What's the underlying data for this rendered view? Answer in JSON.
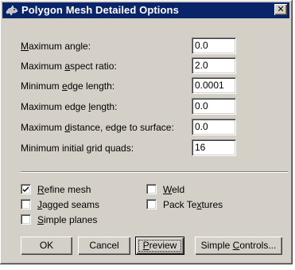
{
  "window": {
    "title": "Polygon Mesh Detailed Options",
    "close_glyph": "✕",
    "app_icon": "rhino-icon",
    "colors": {
      "titlebar": "#0a246a",
      "face": "#d4d0c8"
    }
  },
  "fields": [
    {
      "label_acc": "M",
      "label_rest": "aximum angle:",
      "value": "0.0"
    },
    {
      "label_pre": "Maximum ",
      "label_acc": "a",
      "label_rest": "spect ratio:",
      "value": "2.0"
    },
    {
      "label_pre": "Minimum ",
      "label_acc": "e",
      "label_rest": "dge length:",
      "value": "0.0001"
    },
    {
      "label_pre": "Maximum edge ",
      "label_acc": "l",
      "label_rest": "ength:",
      "value": "0.0"
    },
    {
      "label_pre": "Maximum ",
      "label_acc": "d",
      "label_rest": "istance, edge to surface:",
      "value": "0.0"
    },
    {
      "label_pre": "Minimum initial grid quads:",
      "value": "16"
    }
  ],
  "checkboxes": [
    {
      "label_acc": "R",
      "label_rest": "efine mesh",
      "checked": true
    },
    {
      "label_acc": "J",
      "label_rest": "agged seams",
      "checked": false
    },
    {
      "label_acc": "S",
      "label_rest": "imple planes",
      "checked": false
    },
    {
      "label_acc": "W",
      "label_rest": "eld",
      "checked": false
    },
    {
      "label_pre": "Pack Te",
      "label_acc": "x",
      "label_rest": "tures",
      "checked": false
    }
  ],
  "buttons": {
    "ok": "OK",
    "cancel": "Cancel",
    "preview_acc": "P",
    "preview_rest": "review",
    "simple_pre": "Simple ",
    "simple_acc": "C",
    "simple_rest": "ontrols..."
  }
}
